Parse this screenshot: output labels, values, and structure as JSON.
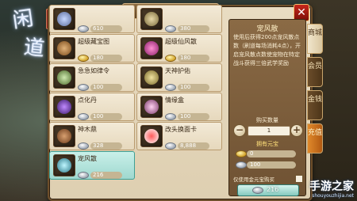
{
  "game_logo": "闲道",
  "badge": "手游",
  "window": {
    "title": "商 城",
    "close": "✕"
  },
  "items": [
    {
      "name": "",
      "price": "610",
      "currency": "silver"
    },
    {
      "name": "",
      "price": "380",
      "currency": "silver"
    },
    {
      "name": "超级藏宝图",
      "price": "180",
      "currency": "gold"
    },
    {
      "name": "超级仙风散",
      "price": "180",
      "currency": "gold"
    },
    {
      "name": "急急如律令",
      "price": "100",
      "currency": "silver"
    },
    {
      "name": "天神护佑",
      "price": "100",
      "currency": "silver"
    },
    {
      "name": "点化丹",
      "price": "100",
      "currency": "silver"
    },
    {
      "name": "情缘盒",
      "price": "100",
      "currency": "silver"
    },
    {
      "name": "神木鼎",
      "price": "328",
      "currency": "silver"
    },
    {
      "name": "改头换面卡",
      "price": "8,888",
      "currency": "silver"
    },
    {
      "name": "宠风散",
      "price": "216",
      "currency": "silver",
      "selected": true
    }
  ],
  "detail": {
    "title": "宠风散",
    "description": "使用后获得200点宠风散点数（刷道每场消耗4点），开启宠风散点数使宠物在特定战斗获得三倍武学奖励",
    "qty_label": "购买数量",
    "qty_value": "1",
    "owned_label": "拥有元宝",
    "owned_gold": "0",
    "owned_silver": "100",
    "checkbox_label": "仅使用金元宝购买",
    "buy_price": "216"
  },
  "tabs": [
    {
      "label": "商城",
      "active": true
    },
    {
      "label": "会员"
    },
    {
      "label": "金钱"
    },
    {
      "label": "充值",
      "charge": true
    }
  ],
  "watermark": {
    "line1": "手游之家",
    "line2": "shouyouzhijia.net"
  }
}
